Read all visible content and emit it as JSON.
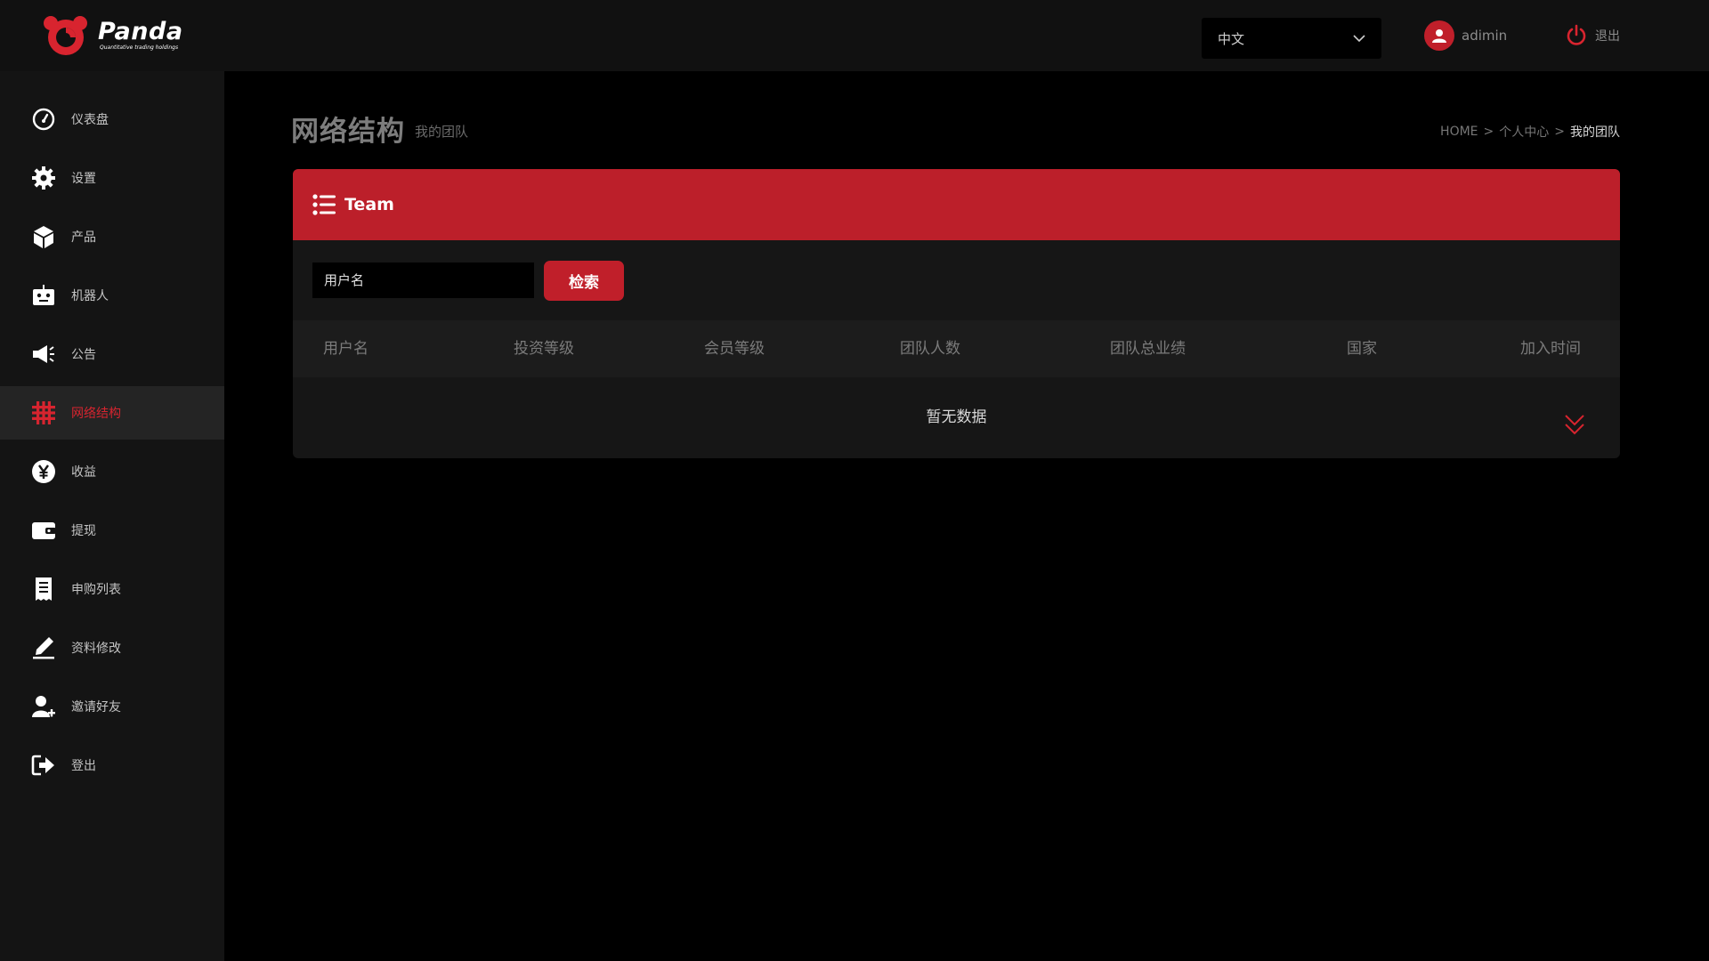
{
  "brand": {
    "name": "Panda",
    "tagline": "Quantitative trading holdings",
    "accent_color": "#c01f2a"
  },
  "topbar": {
    "language": {
      "selected": "中文",
      "icon": "chevron-down-icon"
    },
    "user": {
      "name": "adimin",
      "icon": "user-avatar-icon"
    },
    "logout": {
      "label": "退出",
      "icon": "power-icon"
    }
  },
  "sidebar": {
    "items": [
      {
        "label": "仪表盘",
        "icon": "dashboard-gauge-icon",
        "active": false
      },
      {
        "label": "设置",
        "icon": "gear-icon",
        "active": false
      },
      {
        "label": "产品",
        "icon": "cube-icon",
        "active": false
      },
      {
        "label": "机器人",
        "icon": "robot-icon",
        "active": false
      },
      {
        "label": "公告",
        "icon": "megaphone-icon",
        "active": false
      },
      {
        "label": "网络结构",
        "icon": "grid-hash-icon",
        "active": true
      },
      {
        "label": "收益",
        "icon": "yen-coin-icon",
        "active": false
      },
      {
        "label": "提现",
        "icon": "wallet-icon",
        "active": false
      },
      {
        "label": "申购列表",
        "icon": "receipt-icon",
        "active": false
      },
      {
        "label": "资料修改",
        "icon": "edit-pen-icon",
        "active": false
      },
      {
        "label": "邀请好友",
        "icon": "user-plus-icon",
        "active": false
      },
      {
        "label": "登出",
        "icon": "sign-out-icon",
        "active": false
      }
    ]
  },
  "page": {
    "title": "网络结构",
    "subtitle": "我的团队",
    "breadcrumb": [
      "HOME",
      "个人中心",
      "我的团队"
    ],
    "breadcrumb_separator": ">"
  },
  "panel": {
    "title": "Team",
    "icon": "list-icon",
    "search": {
      "placeholder": "用户名",
      "value": "",
      "button_label": "检索"
    },
    "table": {
      "columns": [
        "用户名",
        "投资等级",
        "会员等级",
        "团队人数",
        "团队总业绩",
        "国家",
        "加入时间"
      ],
      "rows": [],
      "empty_text": "暂无数据",
      "expand_icon": "double-chevron-down-icon"
    }
  }
}
